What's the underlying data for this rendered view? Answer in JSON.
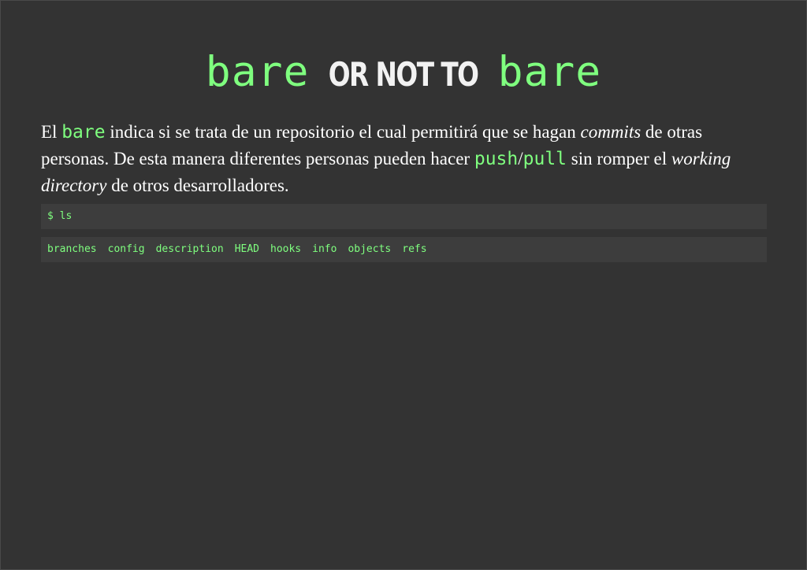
{
  "slide": {
    "title": {
      "code_left": "bare",
      "middle": "OR NOT TO",
      "code_right": "bare"
    },
    "paragraph": {
      "t1": "El ",
      "c1": "bare",
      "t2": " indica si se trata de un repositorio el cual permitirá que se hagan ",
      "e1": "commits",
      "t3": " de otras personas. De esta manera diferentes personas pueden hacer ",
      "c2": "push",
      "t4": "/",
      "c3": "pull",
      "t5": " sin romper el ",
      "e2": "working directory",
      "t6": " de otros desarrolladores."
    },
    "command": "$ ls",
    "output": [
      "branches",
      "config",
      "description",
      "HEAD",
      "hooks",
      "info",
      "objects",
      "refs"
    ]
  },
  "colors": {
    "background": "#333333",
    "code_green": "#7fff7f",
    "code_block_bg": "#3d3d3d",
    "text": "#ffffff"
  }
}
